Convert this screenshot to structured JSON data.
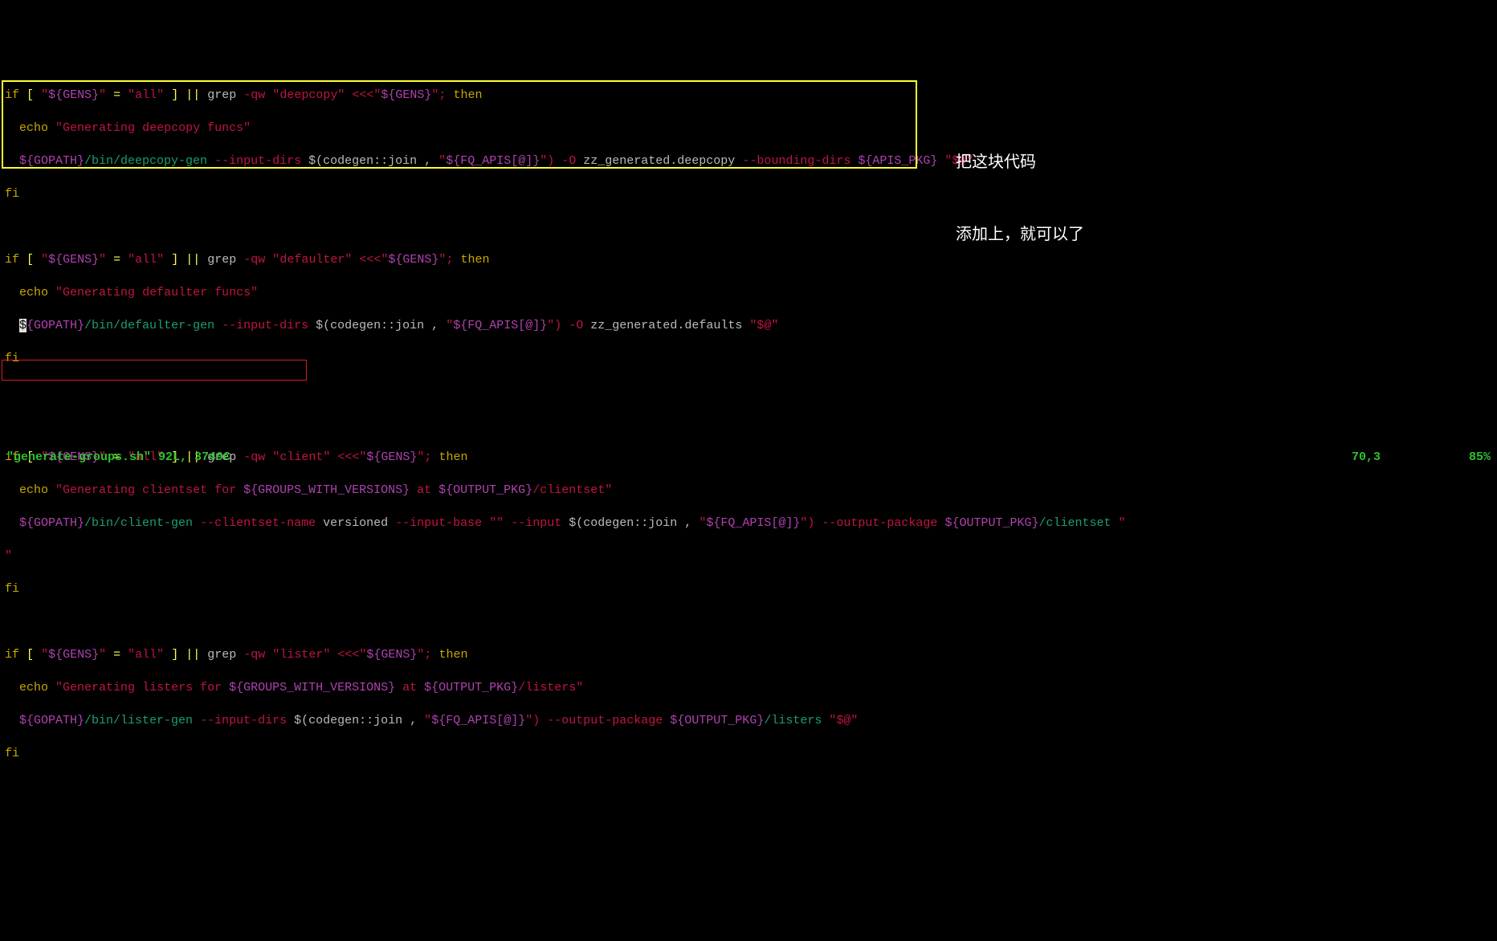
{
  "annotation": {
    "line1": "把这块代码",
    "line2": "添加上，就可以了"
  },
  "statusbar": {
    "file": "\"generate-groups.sh\"",
    "size": "92L, 3749C",
    "pos": "70,3",
    "pct": "85%"
  },
  "code": {
    "l1": {
      "if": "if",
      "lb": "[",
      "q1": "\"",
      "v1": "${GENS}",
      "q1b": "\"",
      "eq": "=",
      "q2": "\"all\"",
      "rb": "]",
      "or": "||",
      "grep": "grep",
      "f": "-qw",
      "q3": "\"",
      "s3": "deepcopy",
      "q3b": "\"",
      "red": "<<<\"",
      "v2": "${GENS}",
      "q4": "\";",
      "then": "then"
    },
    "l2": {
      "echo": "echo",
      "s": "\"Generating deepcopy funcs\""
    },
    "l3": {
      "v": "${GOPATH}",
      "bin": "/bin/deepcopy-gen",
      "f1": "--input-dirs",
      "cg": "$(codegen::join ,",
      "q": "\"",
      "v2": "${FQ_APIS[@]}",
      "q2": "\")",
      "f2": "-O",
      "zz": "zz_generated.deepcopy",
      "f3": "--bounding-dirs",
      "v3": "${APIS_PKG}",
      "q3": "\"$@\""
    },
    "l4": {
      "fi": "fi"
    },
    "l6": {
      "if": "if",
      "lb": "[",
      "q1": "\"",
      "v1": "${GENS}",
      "q1b": "\"",
      "eq": "=",
      "q2": "\"all\"",
      "rb": "]",
      "or": "||",
      "grep": "grep",
      "f": "-qw",
      "q3": "\"",
      "s3": "defaulter",
      "q3b": "\"",
      "red": "<<<\"",
      "v2": "${GENS}",
      "q2b": "\";",
      "then": "then"
    },
    "l7": {
      "echo": "echo",
      "s": "\"Generating defaulter funcs\""
    },
    "l8": {
      "cur": "$",
      "v": "{GOPATH}",
      "bin": "/bin/defaulter-gen",
      "f1": "--input-dirs",
      "cg": "$(codegen::join ,",
      "q": "\"",
      "v2": "${FQ_APIS[@]}",
      "q2": "\")",
      "f2": "-O",
      "zz": "zz_generated.defaults",
      "q3": "\"$@\""
    },
    "l9": {
      "fi": "fi"
    },
    "l12": {
      "if": "if",
      "lb": "[",
      "q1": "\"",
      "v1": "${GENS}",
      "q1b": "\"",
      "eq": "=",
      "q2": "\"all\"",
      "rb": "]",
      "or": "||",
      "grep": "grep",
      "f": "-qw",
      "q3": "\"",
      "s3": "client",
      "q3b": "\"",
      "red": "<<<\"",
      "v2": "${GENS}",
      "q2b": "\";",
      "then": "then"
    },
    "l13": {
      "echo": "echo",
      "s1": "\"Generating clientset for ",
      "v1": "${GROUPS_WITH_VERSIONS}",
      "s2": " at ",
      "v2": "${OUTPUT_PKG}",
      "s3": "/clientset\""
    },
    "l14": {
      "v": "${GOPATH}",
      "bin": "/bin/client-gen",
      "f1": "--clientset-name",
      "ver": "versioned",
      "f2": "--input-base",
      "q1": "\"\"",
      "f3": "--input",
      "cg": "$(codegen::join ,",
      "q2": "\"",
      "v2": "${FQ_APIS[@]}",
      "q3": "\")",
      "f4": "--output-package",
      "v3": "${OUTPUT_PKG}",
      "cs": "/clientset",
      "q4": "\""
    },
    "l15t": "\"",
    "l15": {
      "fi": "fi"
    },
    "l18": {
      "if": "if",
      "lb": "[",
      "q1": "\"",
      "v1": "${GENS}",
      "q1b": "\"",
      "eq": "=",
      "q2": "\"all\"",
      "rb": "]",
      "or": "||",
      "grep": "grep",
      "f": "-qw",
      "q3": "\"",
      "s3": "lister",
      "q3b": "\"",
      "red": "<<<\"",
      "v2": "${GENS}",
      "q2b": "\";",
      "then": "then"
    },
    "l19": {
      "echo": "echo",
      "s1": "\"Generating listers for ",
      "v1": "${GROUPS_WITH_VERSIONS}",
      "s2": " at ",
      "v2": "${OUTPUT_PKG}",
      "s3": "/listers\""
    },
    "l20": {
      "v": "${GOPATH}",
      "bin": "/bin/lister-gen",
      "f1": "--input-dirs",
      "cg": "$(codegen::join ,",
      "q": "\"",
      "v2": "${FQ_APIS[@]}",
      "q2": "\")",
      "f2": "--output-package",
      "v3": "${OUTPUT_PKG}",
      "ls": "/listers",
      "q3": "\"$@\""
    },
    "l21": {
      "fi": "fi"
    }
  }
}
